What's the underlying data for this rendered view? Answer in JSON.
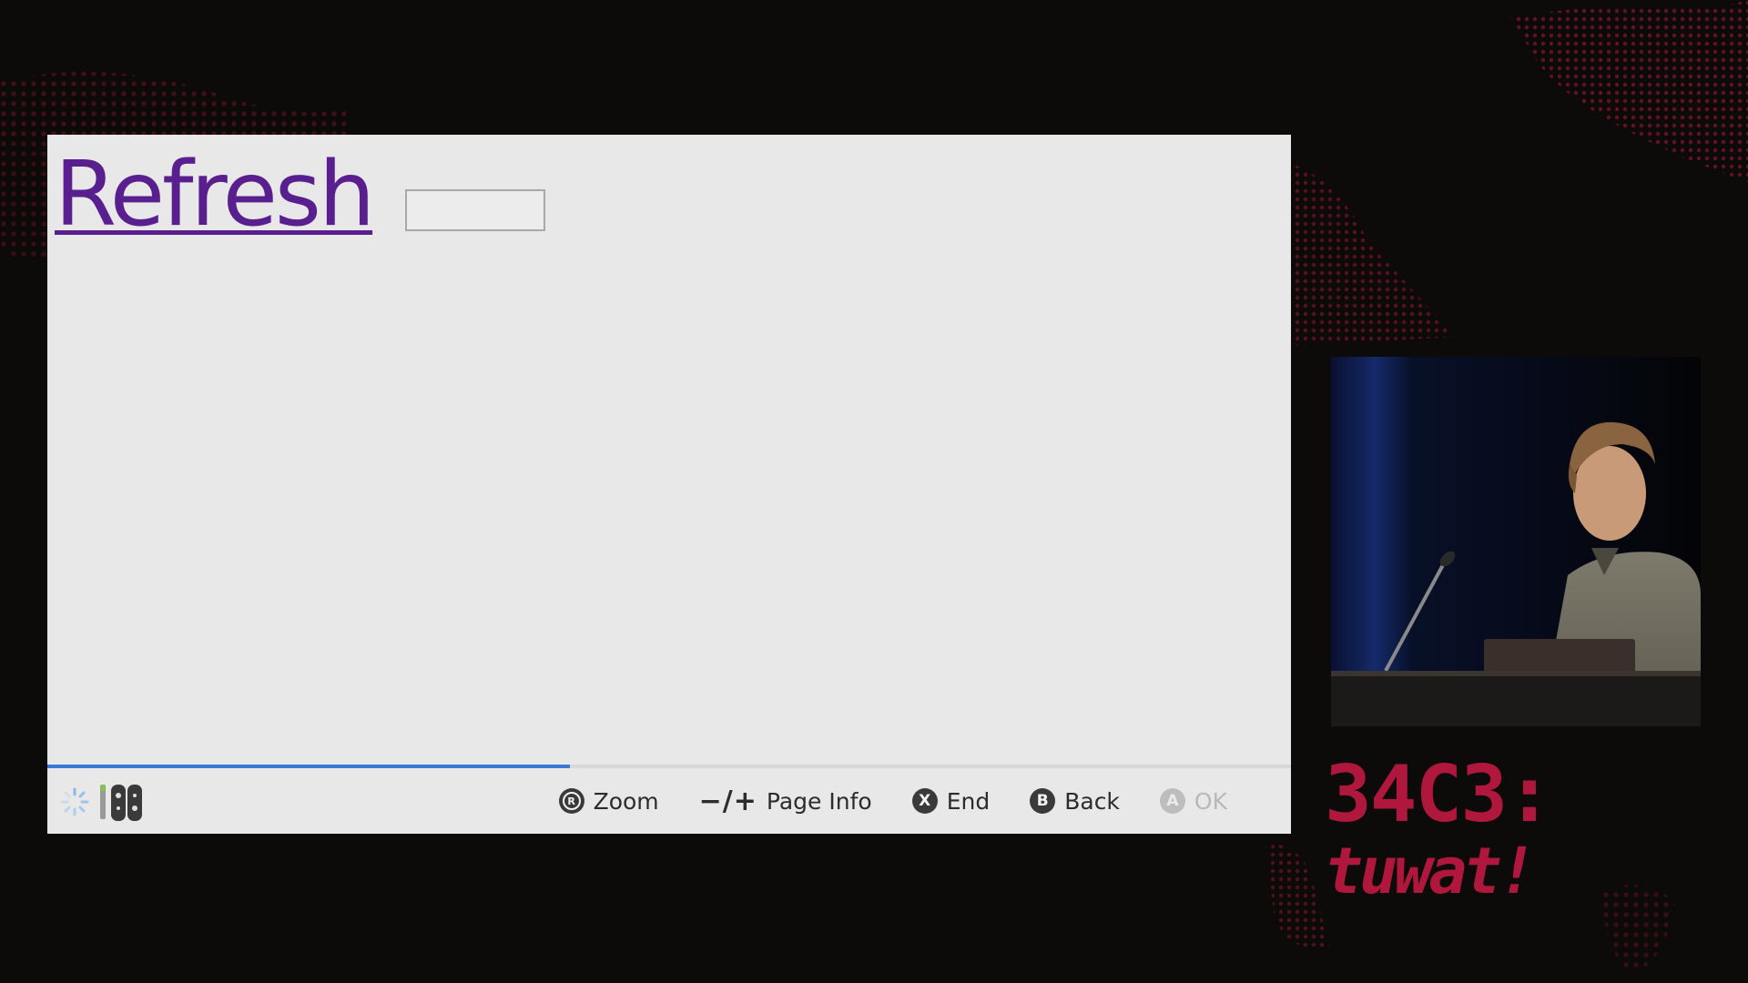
{
  "browser": {
    "link_text": "Refresh",
    "text_box_value": "",
    "load_progress_percent": 42
  },
  "hints": [
    {
      "button": "R",
      "label": "Zoom",
      "enabled": true
    },
    {
      "button": "−/+",
      "label": "Page Info",
      "enabled": true
    },
    {
      "button": "X",
      "label": "End",
      "enabled": true
    },
    {
      "button": "B",
      "label": "Back",
      "enabled": true
    },
    {
      "button": "A",
      "label": "OK",
      "enabled": false
    }
  ],
  "status_icons": [
    "loading-spinner-icon",
    "joycon-controller-icon"
  ],
  "event_logo": {
    "line1": "34C3:",
    "line2": "tuwat!"
  },
  "colors": {
    "background": "#0c0b0a",
    "screen": "#e8e8e8",
    "link": "#5a1f8f",
    "progress": "#3a78d8",
    "logo": "#b0173d"
  }
}
